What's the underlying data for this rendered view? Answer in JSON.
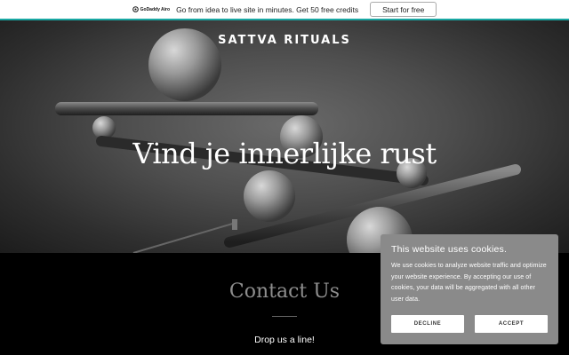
{
  "promo": {
    "logo_text": "GoDaddy Airo",
    "message": "Go from idea to live site in minutes. Get 50 free credits",
    "cta_label": "Start for free"
  },
  "hero": {
    "brand": "SATTVA RITUALS",
    "headline": "Vind je innerlijke rust"
  },
  "contact": {
    "title": "Contact Us",
    "subtitle": "Drop us a line!"
  },
  "cookie_banner": {
    "title": "This website uses cookies.",
    "text": "We use cookies to analyze website traffic and optimize your website experience. By accepting our use of cookies, your data will be aggregated with all other user data.",
    "decline_label": "DECLINE",
    "accept_label": "ACCEPT"
  },
  "colors": {
    "accent": "#19a7a3",
    "cookie_background": "#8a8a8a",
    "contact_title": "#8e8e8e"
  }
}
